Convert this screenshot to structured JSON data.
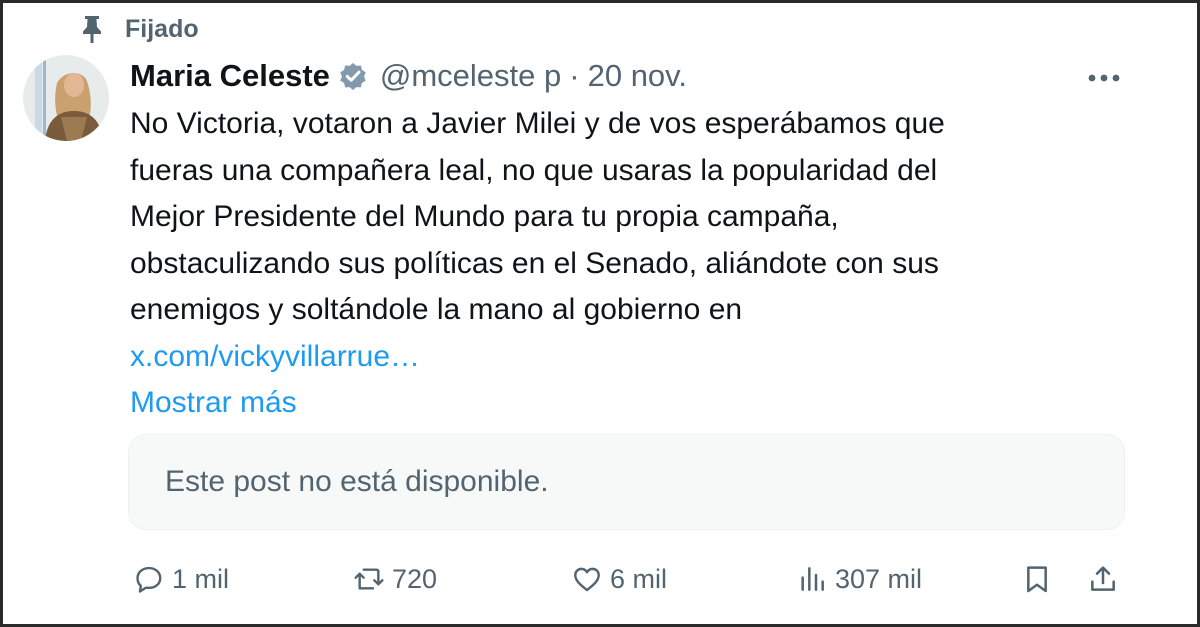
{
  "pinned": {
    "label": "Fijado"
  },
  "author": {
    "name": "Maria Celeste",
    "handle": "@mceleste p",
    "separator": "·",
    "date": "20 nov."
  },
  "post": {
    "lines": [
      "No Victoria, votaron a Javier Milei y de vos esperábamos que",
      "fueras una compañera leal, no que usaras la popularidad del",
      "Mejor Presidente del Mundo para tu propia campaña,",
      "obstaculizando sus políticas en el Senado, aliándote con sus",
      "enemigos y soltándole la mano al gobierno en"
    ],
    "link": "x.com/vickyvillarrue…",
    "show_more": "Mostrar más"
  },
  "quote": {
    "unavailable_text": "Este post no está disponible."
  },
  "actions": {
    "replies": "1 mil",
    "reposts": "720",
    "likes": "6 mil",
    "views": "307 mil"
  },
  "colors": {
    "text": "#0f1419",
    "secondary": "#536471",
    "link": "#1d9bf0",
    "quote_bg": "#f7f9f9",
    "verified_badge": "#829aab"
  },
  "icons": [
    "pin-icon",
    "verified-icon",
    "more-icon",
    "reply-icon",
    "repost-icon",
    "like-icon",
    "views-icon",
    "bookmark-icon",
    "share-icon"
  ]
}
